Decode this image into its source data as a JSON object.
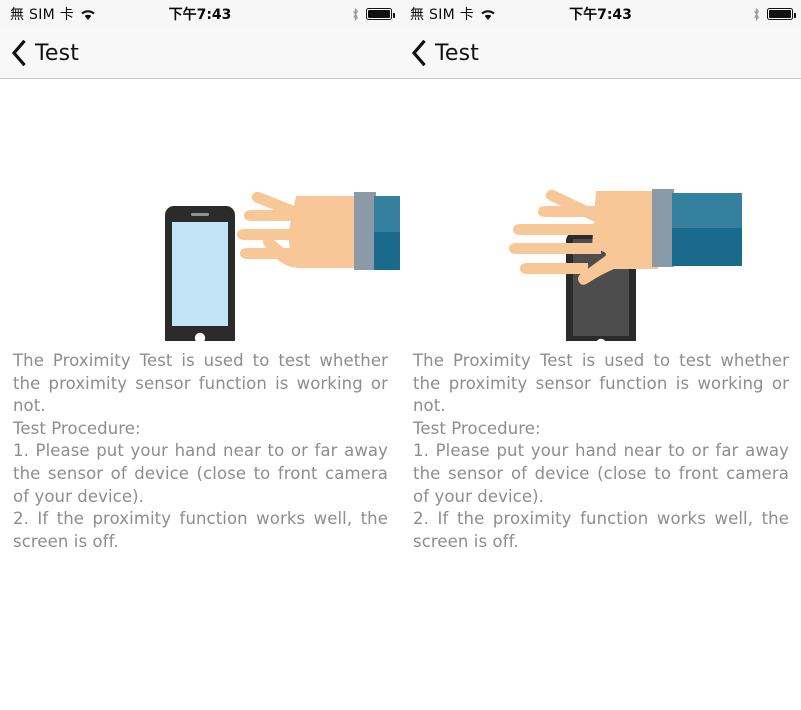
{
  "app": {
    "title": "Test",
    "screens": 2
  },
  "status_bar": {
    "carrier": "無 SIM 卡",
    "wifi_icon": "wifi-icon",
    "time": "下午7:43",
    "bluetooth_icon": "bluetooth-icon",
    "battery_icon": "battery-full-icon",
    "battery_level_percent": 100
  },
  "nav_bar": {
    "back_icon": "chevron-left-icon",
    "title": "Test"
  },
  "illustration": {
    "left": {
      "name": "hand-away-from-phone",
      "phone_screen_state": "on",
      "phone_screen_color": "#c3e3f7",
      "phone_body_color": "#2b2b2b",
      "hand_color": "#f7c797",
      "cuff_color": "#8a9aa6",
      "sleeve_top_color": "#357f9f",
      "sleeve_bottom_color": "#1a6a8d"
    },
    "right": {
      "name": "hand-covering-phone",
      "phone_screen_state": "off",
      "phone_screen_color": "#4d4d4d",
      "phone_body_color": "#2b2b2b",
      "hand_color": "#f7c797",
      "cuff_color": "#8a9aa6",
      "sleeve_top_color": "#357f9f",
      "sleeve_bottom_color": "#1a6a8d"
    }
  },
  "content": {
    "paragraph_1": "The Proximity Test is used to test whether the proximity sensor function is working or not.",
    "paragraph_2": "Test Procedure:",
    "paragraph_3": "1. Please put your hand near to or far away the sensor of device (close to front camera of your device).",
    "paragraph_4": "2. If the proximity function works well, the screen is off."
  },
  "colors": {
    "status_bar_bg": "#f7f7f7",
    "nav_bar_bg": "#f8f8f8",
    "nav_border": "#c9c9c9",
    "body_text": "#8d8d8d",
    "page_bg": "#ffffff"
  }
}
